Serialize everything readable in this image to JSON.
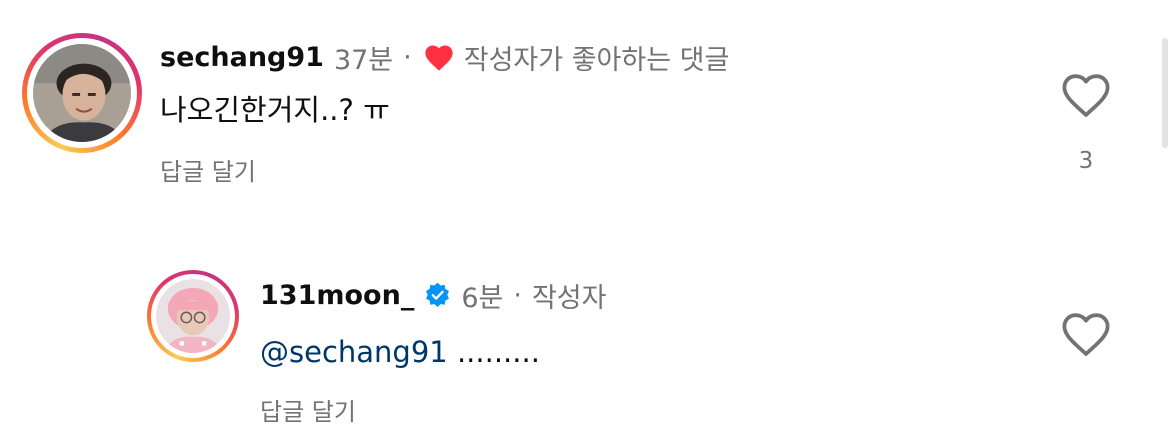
{
  "comments": [
    {
      "username": "sechang91",
      "time": "37분",
      "separator": "·",
      "liked_by_author_label": "작성자가 좋아하는 댓글",
      "text": "나오긴한거지..? ㅠ",
      "reply_label": "답글 달기",
      "like_count": "3",
      "liked_heart_color": "#ff3040"
    },
    {
      "username": "131moon_",
      "verified": true,
      "time": "6분",
      "separator": "·",
      "author_label": "작성자",
      "mention": "@sechang91",
      "text": " .........",
      "reply_label": "답글 달기"
    }
  ],
  "colors": {
    "secondary_text": "#737373",
    "mention": "#00376b",
    "verified_badge": "#0095f6"
  },
  "icons": {
    "like": "heart-outline-icon",
    "liked_by_author": "heart-filled-icon",
    "verified": "verified-badge-icon"
  }
}
